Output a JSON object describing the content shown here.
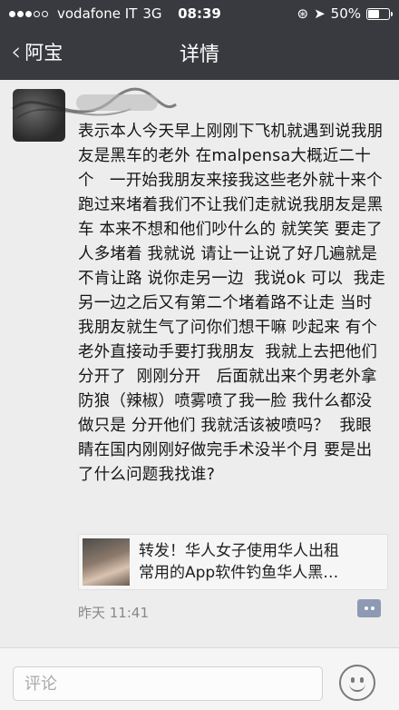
{
  "status_bar": {
    "carrier": "vodafone IT",
    "network": "3G",
    "time": "08:39",
    "battery_percent_text": "50%",
    "battery_level": 0.5
  },
  "nav": {
    "back_label": "阿宝",
    "title": "详情"
  },
  "post": {
    "message": "表示本人今天早上刚刚下飞机就遇到说我朋友是黑车的老外 在malpensa大概近二十个   一开始我朋友来接我这些老外就十来个跑过来堵着我们不让我们走就说我朋友是黑车 本来不想和他们吵什么的 就笑笑 要走了 人多堵着 我就说 请让一让说了好几遍就是不肯让路 说你走另一边  我说ok 可以  我走另一边之后又有第二个堵着路不让走 当时我朋友就生气了问你们想干嘛 吵起来 有个老外直接动手要打我朋友  我就上去把他们分开了  刚刚分开   后面就出来个男老外拿防狼（辣椒）喷雾喷了我一脸 我什么都没做只是 分开他们 我就活该被喷吗？  我眼睛在国内刚刚好做完手术没半个月 要是出了什么问题我找谁?",
    "link_line1": "转发！华人女子使用华人出租",
    "link_line2": "常用的App软件钓鱼华人黑…",
    "time": "昨天 11:41"
  },
  "bottom": {
    "comment_placeholder": "评论"
  },
  "colors": {
    "header_bg": "#393a3f",
    "more_button": "#8e99b3"
  }
}
